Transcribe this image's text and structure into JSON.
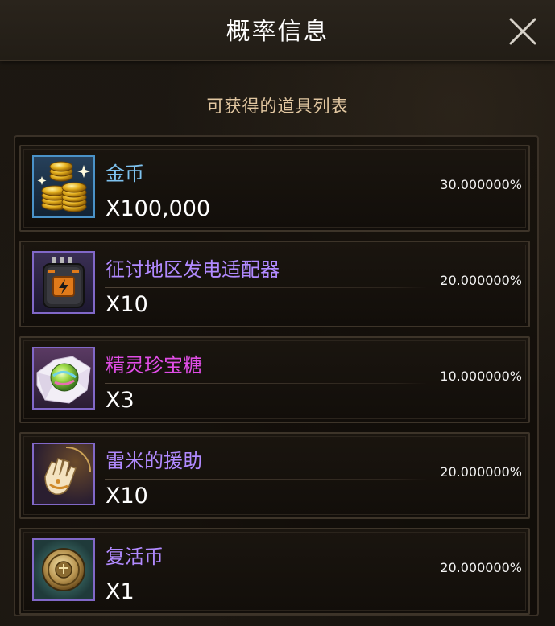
{
  "header": {
    "title": "概率信息"
  },
  "subtitle": "可获得的道具列表",
  "items": [
    {
      "name": "金币",
      "name_color": "#7ec3f0",
      "quantity": "X100,000",
      "probability": "30.000000%",
      "icon": "gold-coins-icon"
    },
    {
      "name": "征讨地区发电适配器",
      "name_color": "#b18aff",
      "quantity": "X10",
      "probability": "20.000000%",
      "icon": "power-adapter-icon"
    },
    {
      "name": "精灵珍宝糖",
      "name_color": "#e04de6",
      "quantity": "X3",
      "probability": "10.000000%",
      "icon": "candy-icon"
    },
    {
      "name": "雷米的援助",
      "name_color": "#b18aff",
      "quantity": "X10",
      "probability": "20.000000%",
      "icon": "glove-icon"
    },
    {
      "name": "复活币",
      "name_color": "#b18aff",
      "quantity": "X1",
      "probability": "20.000000%",
      "icon": "revival-coin-icon"
    }
  ]
}
